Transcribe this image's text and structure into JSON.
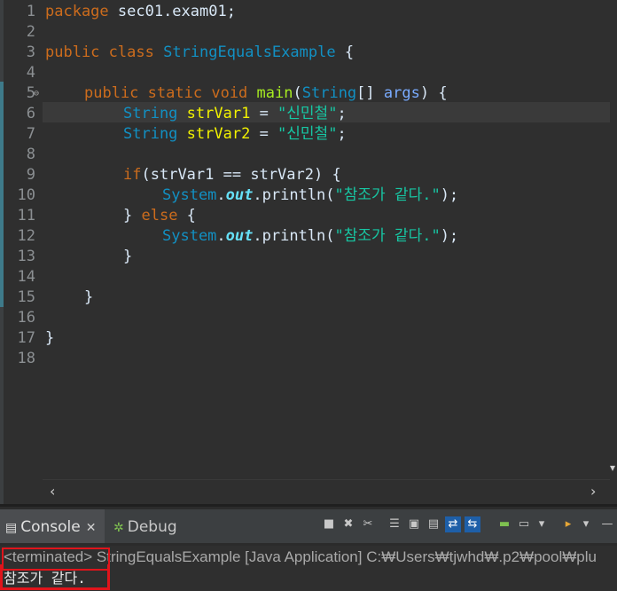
{
  "editor": {
    "line_numbers": [
      "1",
      "2",
      "3",
      "4",
      "5",
      "6",
      "7",
      "8",
      "9",
      "10",
      "11",
      "12",
      "13",
      "14",
      "15",
      "16",
      "17",
      "18"
    ],
    "code": {
      "l1_kw": "package",
      "l1_rest": " sec01.exam01;",
      "l3_kw1": "public",
      "l3_kw2": "class",
      "l3_type": "StringEqualsExample",
      "l3_rest": " {",
      "l5_kw1": "public",
      "l5_kw2": "static",
      "l5_kw3": "void",
      "l5_method": "main",
      "l5_p1": "(",
      "l5_type": "String",
      "l5_p2": "[] ",
      "l5_var": "args",
      "l5_p3": ") {",
      "l6_type": "String",
      "l6_var": "strVar1",
      "l6_eq": " = ",
      "l6_str": "\"신민철\"",
      "l6_end": ";",
      "l7_type": "String",
      "l7_var": "strVar2",
      "l7_eq": " = ",
      "l7_str": "\"신민철\"",
      "l7_end": ";",
      "l9_kw": "if",
      "l9_p1": "(",
      "l9_v1": "strVar1",
      "l9_op": " == ",
      "l9_v2": "strVar2",
      "l9_p2": ") {",
      "l10_type": "System",
      "l10_dot1": ".",
      "l10_field": "out",
      "l10_dot2": ".",
      "l10_method": "println",
      "l10_p1": "(",
      "l10_str": "\"참조가 같다.\"",
      "l10_p2": ");",
      "l11_p1": "} ",
      "l11_kw": "else",
      "l11_p2": " {",
      "l12_type": "System",
      "l12_dot1": ".",
      "l12_field": "out",
      "l12_dot2": ".",
      "l12_method": "println",
      "l12_p1": "(",
      "l12_str": "\"참조가 같다.\"",
      "l12_p2": ");",
      "l13": "}",
      "l15": "}",
      "l17": "}"
    },
    "fold_glyph": "⊖",
    "scroll_left": "‹",
    "scroll_right": "›",
    "scroll_down": "▾"
  },
  "console": {
    "tab_console_label": "Console",
    "tab_console_icon": "▤",
    "tab_close": "✕",
    "tab_debug_label": "Debug",
    "tab_debug_icon": "✲",
    "terminated_tag": "<terminated>",
    "terminated_rest": " StringEqualsExample [Java Application] C:₩Users₩tjwhd₩.p2₩pool₩plu",
    "output": "참조가 같다.",
    "toolbar_icons": [
      "■",
      "✖",
      "✂",
      "☰",
      "▣",
      "▤",
      "⇄",
      "⇆",
      "▬",
      "▭",
      "▾",
      "▸",
      "▾",
      "—"
    ]
  },
  "colors": {
    "keyword": "#cc6c1d",
    "type": "#1290c3",
    "variable": "#f2f200",
    "string": "#17c6a3",
    "highlight": "#e0141b"
  }
}
